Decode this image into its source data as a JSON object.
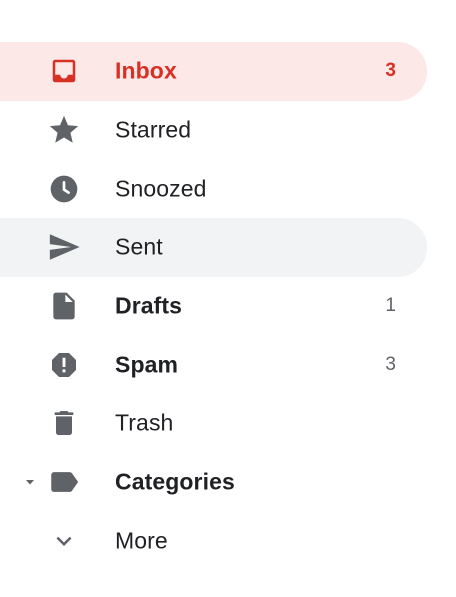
{
  "colors": {
    "accent": "#d93025",
    "active_bg": "#fce8e6",
    "hover_bg": "#f1f3f4",
    "icon": "#5f6368",
    "text": "#202124"
  },
  "nav": {
    "items": [
      {
        "label": "Inbox",
        "count": "3",
        "icon": "inbox-icon",
        "state": "active"
      },
      {
        "label": "Starred",
        "count": "",
        "icon": "star-icon",
        "state": "normal"
      },
      {
        "label": "Snoozed",
        "count": "",
        "icon": "clock-icon",
        "state": "normal"
      },
      {
        "label": "Sent",
        "count": "",
        "icon": "send-icon",
        "state": "hover"
      },
      {
        "label": "Drafts",
        "count": "1",
        "icon": "draft-icon",
        "state": "normal"
      },
      {
        "label": "Spam",
        "count": "3",
        "icon": "spam-icon",
        "state": "normal"
      },
      {
        "label": "Trash",
        "count": "",
        "icon": "trash-icon",
        "state": "normal"
      },
      {
        "label": "Categories",
        "count": "",
        "icon": "label-icon",
        "state": "normal",
        "expander": "caret-down-icon"
      },
      {
        "label": "More",
        "count": "",
        "icon": "chevron-down-icon",
        "state": "normal"
      }
    ]
  }
}
